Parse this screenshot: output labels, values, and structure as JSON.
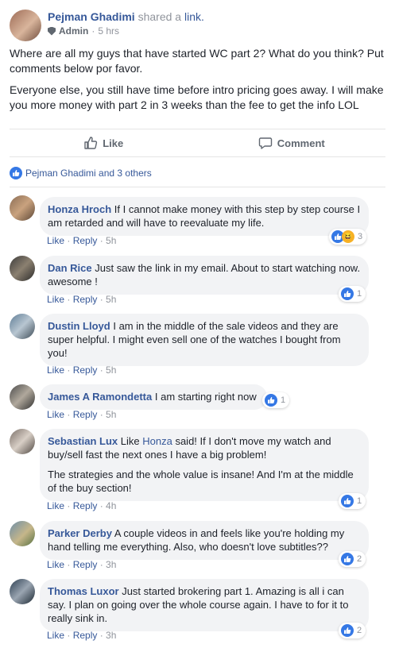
{
  "post": {
    "author": "Pejman Ghadimi",
    "action": "shared a",
    "link_text": "link.",
    "role": "Admin",
    "time": "5 hrs",
    "body": [
      "Where are all my guys that have started WC part 2? What do you think? Put comments below por favor.",
      "Everyone else, you still have time before intro pricing goes away. I will make you more money with part 2 in 3 weeks than the fee to get the info LOL"
    ]
  },
  "actions": {
    "like": "Like",
    "comment": "Comment"
  },
  "likes_summary": "Pejman Ghadimi and 3 others",
  "colors": {
    "link": "#365899",
    "like_blue": "#3578e5",
    "bubble": "#f2f3f5",
    "muted": "#90949c"
  },
  "comments": [
    {
      "name": "Honza Hroch",
      "text": "If I cannot make money with this step by step course I am retarded and will have to reevaluate my life.",
      "like": "Like",
      "reply": "Reply",
      "time": "5h",
      "reactions": [
        "like-icon",
        "haha-icon"
      ],
      "react_count": "3"
    },
    {
      "name": "Dan Rice",
      "text": "Just saw the link in my email. About to start watching now. awesome !",
      "like": "Like",
      "reply": "Reply",
      "time": "5h",
      "reactions": [
        "like-icon"
      ],
      "react_count": "1"
    },
    {
      "name": "Dustin Lloyd",
      "text": "I am in the middle of the sale videos and they are super helpful. I might even sell one of the watches I bought from you!",
      "like": "Like",
      "reply": "Reply",
      "time": "5h",
      "reactions": [],
      "react_count": ""
    },
    {
      "name": "James A Ramondetta",
      "text": "I am starting right now",
      "like": "Like",
      "reply": "Reply",
      "time": "5h",
      "reactions": [
        "like-icon"
      ],
      "react_count": "1"
    },
    {
      "name": "Sebastian Lux",
      "text_pre": "Like",
      "mention": "Honza",
      "text_post": "said! If I don't move my watch and buy/sell fast the next ones I have a big problem!",
      "text2": "The strategies and the whole value is insane! And I'm at the middle of the buy section!",
      "like": "Like",
      "reply": "Reply",
      "time": "4h",
      "reactions": [
        "like-icon"
      ],
      "react_count": "1"
    },
    {
      "name": "Parker Derby",
      "text": "A couple videos in and feels like you're holding my hand telling me everything. Also, who doesn't love subtitles??",
      "like": "Like",
      "reply": "Reply",
      "time": "3h",
      "reactions": [
        "like-icon"
      ],
      "react_count": "2"
    },
    {
      "name": "Thomas Luxor",
      "text": "Just started brokering part 1. Amazing is all i can say. I plan on going over the whole course again. I have to for it to really sink in.",
      "like": "Like",
      "reply": "Reply",
      "time": "3h",
      "reactions": [
        "like-icon"
      ],
      "react_count": "2"
    }
  ]
}
